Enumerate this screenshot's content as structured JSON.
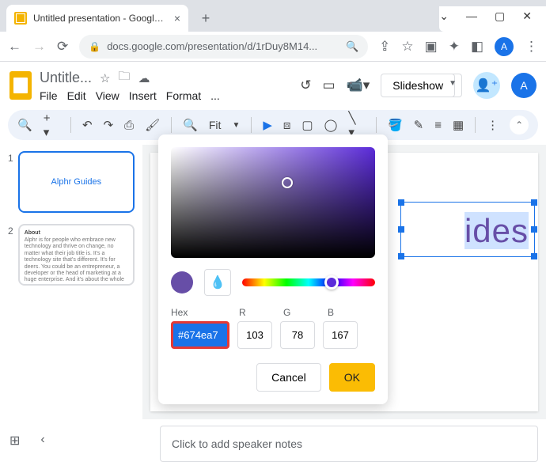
{
  "browser": {
    "tab_title": "Untitled presentation - Google Sl",
    "url": "docs.google.com/presentation/d/1rDuy8M14...",
    "avatar_letter": "A"
  },
  "header": {
    "doc_title": "Untitle...",
    "menus": [
      "File",
      "Edit",
      "View",
      "Insert",
      "Format",
      "..."
    ],
    "slideshow_label": "Slideshow",
    "avatar_letter": "A"
  },
  "toolbar": {
    "zoom_label": "Fit"
  },
  "thumbs": [
    {
      "num": "1",
      "title": "Alphr Guides"
    },
    {
      "num": "2",
      "title": "About",
      "body": "Alphr is for people who embrace new technology and thrive on change, no matter what their job title is. It's a technology site that's different. It's for deers. You could be an entrepreneur, a developer or the head of marketing at a huge enterprise. And it's about the whole of your life, because you don't stop using technology when you leave the office"
    }
  ],
  "canvas": {
    "guides_text": "ides"
  },
  "notes": {
    "placeholder": "Click to add speaker notes"
  },
  "picker": {
    "hex_label": "Hex",
    "r_label": "R",
    "g_label": "G",
    "b_label": "B",
    "hex": "#674ea7",
    "r": "103",
    "g": "78",
    "b": "167",
    "cancel": "Cancel",
    "ok": "OK"
  }
}
